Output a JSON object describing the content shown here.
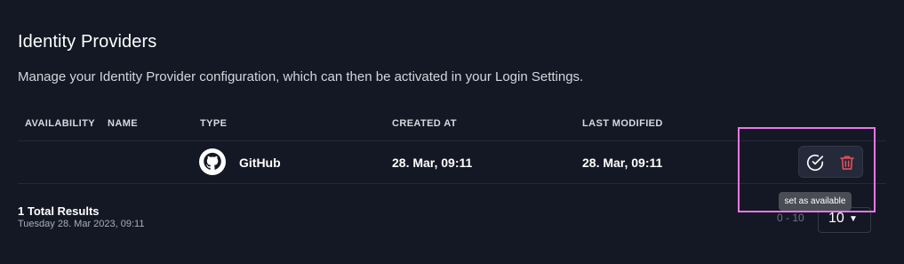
{
  "page": {
    "title": "Identity Providers",
    "description": "Manage your Identity Provider configuration, which can then be activated in your Login Settings."
  },
  "table": {
    "headers": {
      "availability": "AVAILABILITY",
      "name": "NAME",
      "type": "TYPE",
      "created_at": "CREATED AT",
      "last_modified": "LAST MODIFIED"
    },
    "rows": [
      {
        "availability": "",
        "name": "",
        "type": "GitHub",
        "type_icon": "github-icon",
        "created_at": "28. Mar, 09:11",
        "last_modified": "28. Mar, 09:11"
      }
    ]
  },
  "actions": {
    "set_available_icon": "check-circle-icon",
    "delete_icon": "trash-icon",
    "tooltip": "set as available"
  },
  "footer": {
    "total_results": "1 Total Results",
    "timestamp": "Tuesday 28. Mar 2023, 09:11",
    "range": "0 - 10",
    "page_size": "10"
  },
  "colors": {
    "background": "#141824",
    "highlight": "#e777e6",
    "delete": "#e3505c",
    "tooltip_bg": "#4a4d56"
  }
}
